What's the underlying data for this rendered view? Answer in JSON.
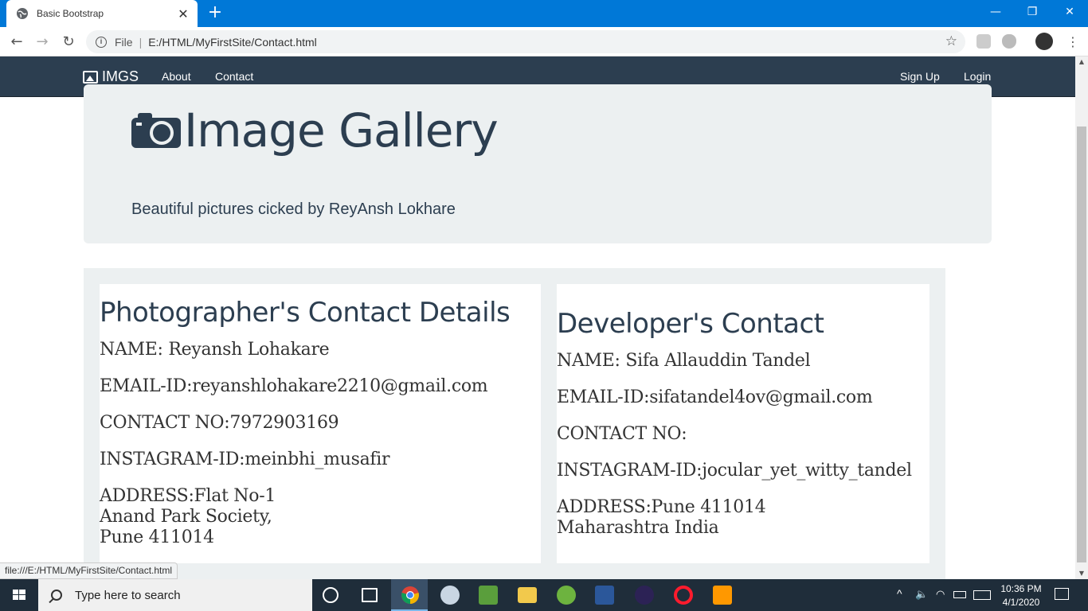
{
  "browser": {
    "tab_title": "Basic Bootstrap",
    "scheme_label": "File",
    "url": "E:/HTML/MyFirstSite/Contact.html",
    "status_url": "file:///E:/HTML/MyFirstSite/Contact.html"
  },
  "navbar": {
    "brand": "IMGS",
    "left_links": [
      "About",
      "Contact"
    ],
    "right_links": [
      "Sign Up",
      "Login"
    ]
  },
  "jumbotron": {
    "title": "Image Gallery",
    "subtitle": "Beautiful pictures cicked by ReyAnsh Lokhare"
  },
  "photographer": {
    "heading": "Photographer's Contact Details",
    "name": "NAME: Reyansh Lohakare",
    "email": "EMAIL-ID:reyanshlohakare2210@gmail.com",
    "phone": "CONTACT NO:7972903169",
    "instagram": "INSTAGRAM-ID:meinbhi_musafir",
    "address_lines": [
      "ADDRESS:Flat No-1",
      "Anand Park Society,",
      "Pune 411014"
    ]
  },
  "developer": {
    "heading": "Developer's Contact",
    "name": "NAME: Sifa Allauddin Tandel",
    "email": "EMAIL-ID:sifatandel4ov@gmail.com",
    "phone": "CONTACT NO:",
    "instagram": "INSTAGRAM-ID:jocular_yet_witty_tandel",
    "address_lines": [
      "ADDRESS:Pune 411014",
      "Maharashtra India"
    ]
  },
  "taskbar": {
    "search_placeholder": "Type here to search",
    "time": "10:36 PM",
    "date": "4/1/2020"
  },
  "colors": {
    "navbar_bg": "#2c3e50",
    "jumbotron_bg": "#ecf0f1",
    "titlebar_bg": "#0078d7",
    "taskbar_bg": "#1f2d3a"
  },
  "icons": [
    "globe-icon",
    "close-icon",
    "plus-icon",
    "minimize-icon",
    "maximize-icon",
    "window-close-icon",
    "back-arrow-icon",
    "forward-arrow-icon",
    "reload-icon",
    "info-icon",
    "star-icon",
    "image-icon",
    "camera-icon",
    "windows-start-icon",
    "search-icon",
    "cortana-icon",
    "task-view-icon",
    "chrome-icon",
    "wifi-icon",
    "speaker-icon",
    "battery-icon",
    "keyboard-icon",
    "notification-icon"
  ]
}
